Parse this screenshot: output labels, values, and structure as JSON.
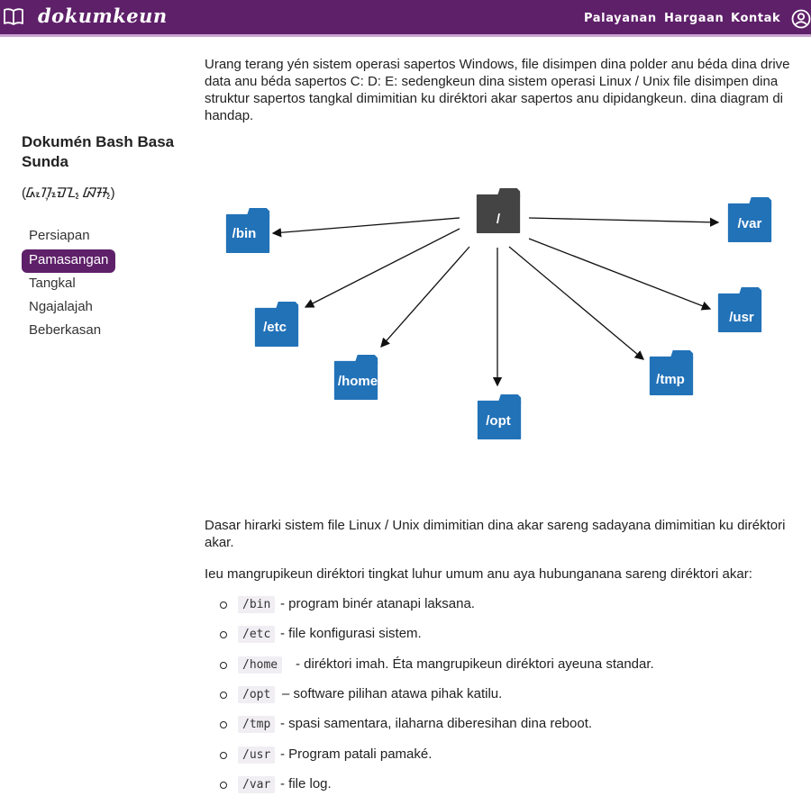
{
  "header": {
    "logo_icon": "book-open-icon",
    "brand": "dokumkeun",
    "nav": [
      "Palayanan",
      "Hargaan",
      "Kontak"
    ],
    "user_icon": "user-circle-icon",
    "color": "#5e2069"
  },
  "sidebar": {
    "title": "Dokumén Bash Basa Sunda",
    "subtitle": "(ᮓᮧᮊᮥᮙᮦᮔ᮪ ᮘᮞ᮪)",
    "items": [
      {
        "label": "Persiapan",
        "active": false
      },
      {
        "label": "Pamasangan",
        "active": true
      },
      {
        "label": "Tangkal",
        "active": false
      },
      {
        "label": "Ngajalajah",
        "active": false
      },
      {
        "label": "Beberkasan",
        "active": false
      }
    ]
  },
  "content": {
    "intro": "Urang terang yén sistem operasi sapertos Windows, file disimpen dina polder anu béda dina drive data anu béda sapertos C: D: E: sedengkeun dina sistem operasi Linux / Unix file disimpen dina struktur sapertos tangkal dimimitian ku diréktori akar sapertos anu dipidangkeun. dina diagram di handap.",
    "diagram": {
      "root": "/",
      "folders": [
        "/bin",
        "/etc",
        "/home",
        "/opt",
        "/tmp",
        "/usr",
        "/var"
      ],
      "root_color": "#444444",
      "folder_color": "#2272b8"
    },
    "para2": "Dasar hirarki sistem file Linux / Unix dimimitian dina akar sareng sadayana dimimitian ku diréktori akar.",
    "para3": "Ieu mangrupikeun diréktori tingkat luhur umum anu aya hubunganana sareng diréktori akar:",
    "list": [
      {
        "code": "/bin",
        "desc": "- program binér atanapi laksana."
      },
      {
        "code": "/etc",
        "desc": "- file konfigurasi sistem."
      },
      {
        "code": "/home",
        "desc": "- diréktori imah. Éta mangrupikeun diréktori ayeuna standar."
      },
      {
        "code": "/opt",
        "desc": "– software pilihan atawa pihak katilu."
      },
      {
        "code": "/tmp",
        "desc": "- spasi samentara, ilaharna diberesihan dina reboot."
      },
      {
        "code": "/usr",
        "desc": "- Program patali pamaké."
      },
      {
        "code": "/var",
        "desc": "- file log."
      }
    ]
  }
}
